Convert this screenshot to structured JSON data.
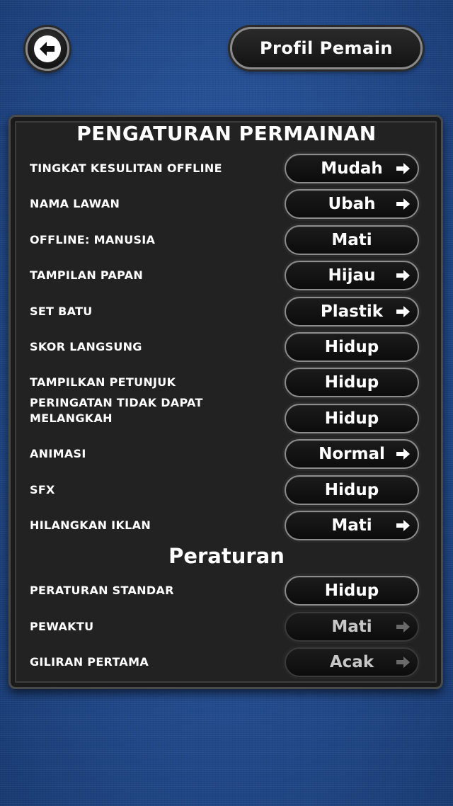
{
  "header": {
    "back_icon": "back-arrow-icon",
    "profile_label": "Profil Pemain"
  },
  "game_settings": {
    "title": "PENGATURAN PERMAINAN",
    "rows": [
      {
        "label": "TINGKAT KESULITAN OFFLINE",
        "value": "Mudah",
        "arrow": true
      },
      {
        "label": "NAMA LAWAN",
        "value": "Ubah",
        "arrow": true
      },
      {
        "label": "OFFLINE: MANUSIA",
        "value": "Mati",
        "arrow": false
      },
      {
        "label": "TAMPILAN PAPAN",
        "value": "Hijau",
        "arrow": true
      },
      {
        "label": "SET BATU",
        "value": "Plastik",
        "arrow": true
      },
      {
        "label": "SKOR LANGSUNG",
        "value": "Hidup",
        "arrow": false
      },
      {
        "label": "TAMPILKAN PETUNJUK",
        "value": "Hidup",
        "arrow": false
      },
      {
        "label": "PERINGATAN TIDAK DAPAT MELANGKAH",
        "value": "Hidup",
        "arrow": false
      },
      {
        "label": "ANIMASI",
        "value": "Normal",
        "arrow": true
      },
      {
        "label": "SFX",
        "value": "Hidup",
        "arrow": false
      },
      {
        "label": "HILANGKAN IKLAN",
        "value": "Mati",
        "arrow": true
      }
    ]
  },
  "rules": {
    "title": "Peraturan",
    "rows": [
      {
        "label": "PERATURAN STANDAR",
        "value": "Hidup",
        "arrow": false,
        "enabled": true
      },
      {
        "label": "PEWAKTU",
        "value": "Mati",
        "arrow": true,
        "enabled": false
      },
      {
        "label": "GILIRAN PERTAMA",
        "value": "Acak",
        "arrow": true,
        "enabled": false
      }
    ]
  },
  "colors": {
    "background": "#254f93",
    "panel": "#222222",
    "text": "#ffffff",
    "disabled_text": "#c7c7c7"
  }
}
